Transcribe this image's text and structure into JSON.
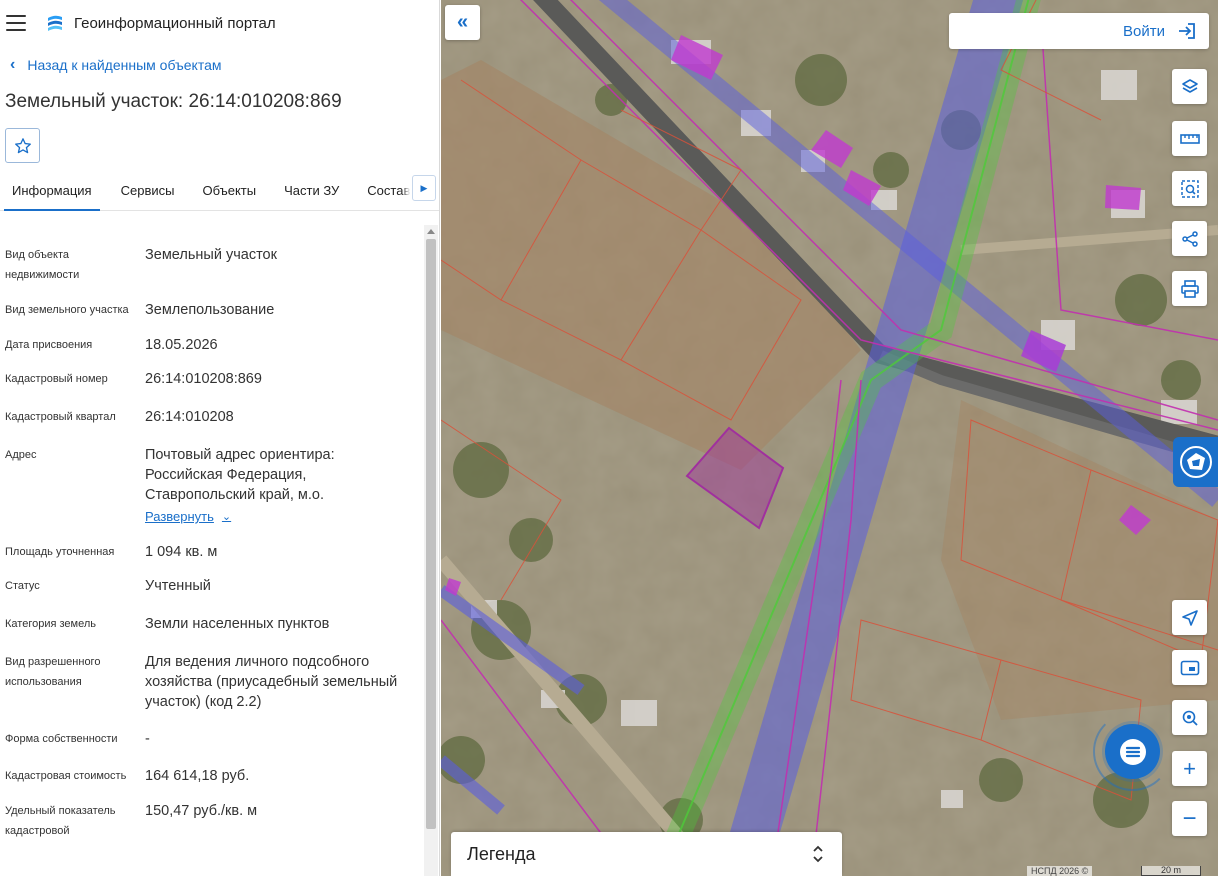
{
  "header": {
    "portal_title": "Геоинформационный портал"
  },
  "nav": {
    "back_label": "Назад к найденным объектам"
  },
  "object": {
    "title": "Земельный участок: 26:14:010208:869"
  },
  "tabs": [
    "Информация",
    "Сервисы",
    "Объекты",
    "Части ЗУ",
    "Состав"
  ],
  "info": {
    "rows": [
      {
        "label": "Вид объекта недвижимости",
        "value": "Земельный участок"
      },
      {
        "label": "Вид земельного участка",
        "value": "Землепользование"
      },
      {
        "label": "Дата присвоения",
        "value": "18.05.2026"
      },
      {
        "label": "Кадастровый номер",
        "value": "26:14:010208:869"
      },
      {
        "label": "Кадастровый квартал",
        "value": "26:14:010208"
      },
      {
        "label": "Адрес",
        "value": "Почтовый адрес ориентира: Российская Федерация, Ставропольский край, м.о."
      },
      {
        "label": "Площадь уточненная",
        "value": "1 094 кв. м"
      },
      {
        "label": "Статус",
        "value": "Учтенный"
      },
      {
        "label": "Категория земель",
        "value": "Земли населенных пунктов"
      },
      {
        "label": "Вид разрешенного использования",
        "value": "Для ведения личного подсобного хозяйства (приусадебный земельный участок) (код 2.2)"
      },
      {
        "label": "Форма собственности",
        "value": "-"
      },
      {
        "label": "Кадастровая стоимость",
        "value": "164 614,18 руб."
      },
      {
        "label": "Удельный показатель кадастровой",
        "value": "150,47 руб./кв. м"
      }
    ],
    "expand_label": "Развернуть"
  },
  "map": {
    "login_label": "Войти",
    "legend_label": "Легенда",
    "attribution": "НСПД 2026 ©",
    "scale_label": "20 m"
  },
  "icons": {
    "menu": "hamburger-icon",
    "logo": "portal-logo-icon",
    "back": "chevron-left-icon",
    "favorite": "star-icon",
    "tabs_next": "caret-right-icon",
    "expand": "chevron-down-icon",
    "collapse": "double-chevron-left-icon",
    "login": "login-arrow-icon",
    "layers": "layers-icon",
    "ruler": "ruler-icon",
    "select": "area-select-icon",
    "share": "share-icon",
    "print": "print-icon",
    "rosreestr": "rosreestr-logo-icon",
    "locate": "navigation-arrow-icon",
    "screen": "screen-icon",
    "geo_search": "geo-search-icon",
    "zoom_in": "plus-icon",
    "zoom_out": "minus-icon",
    "chat": "chat-icon",
    "legend_toggle": "chevron-up-down-icon"
  },
  "colors": {
    "accent": "#1a6fc9",
    "selected_parcel": "#a0309e",
    "parcel_border": "#d9513a",
    "zone_blue": "#5a5ee0",
    "zone_green": "#4ecb3a"
  }
}
